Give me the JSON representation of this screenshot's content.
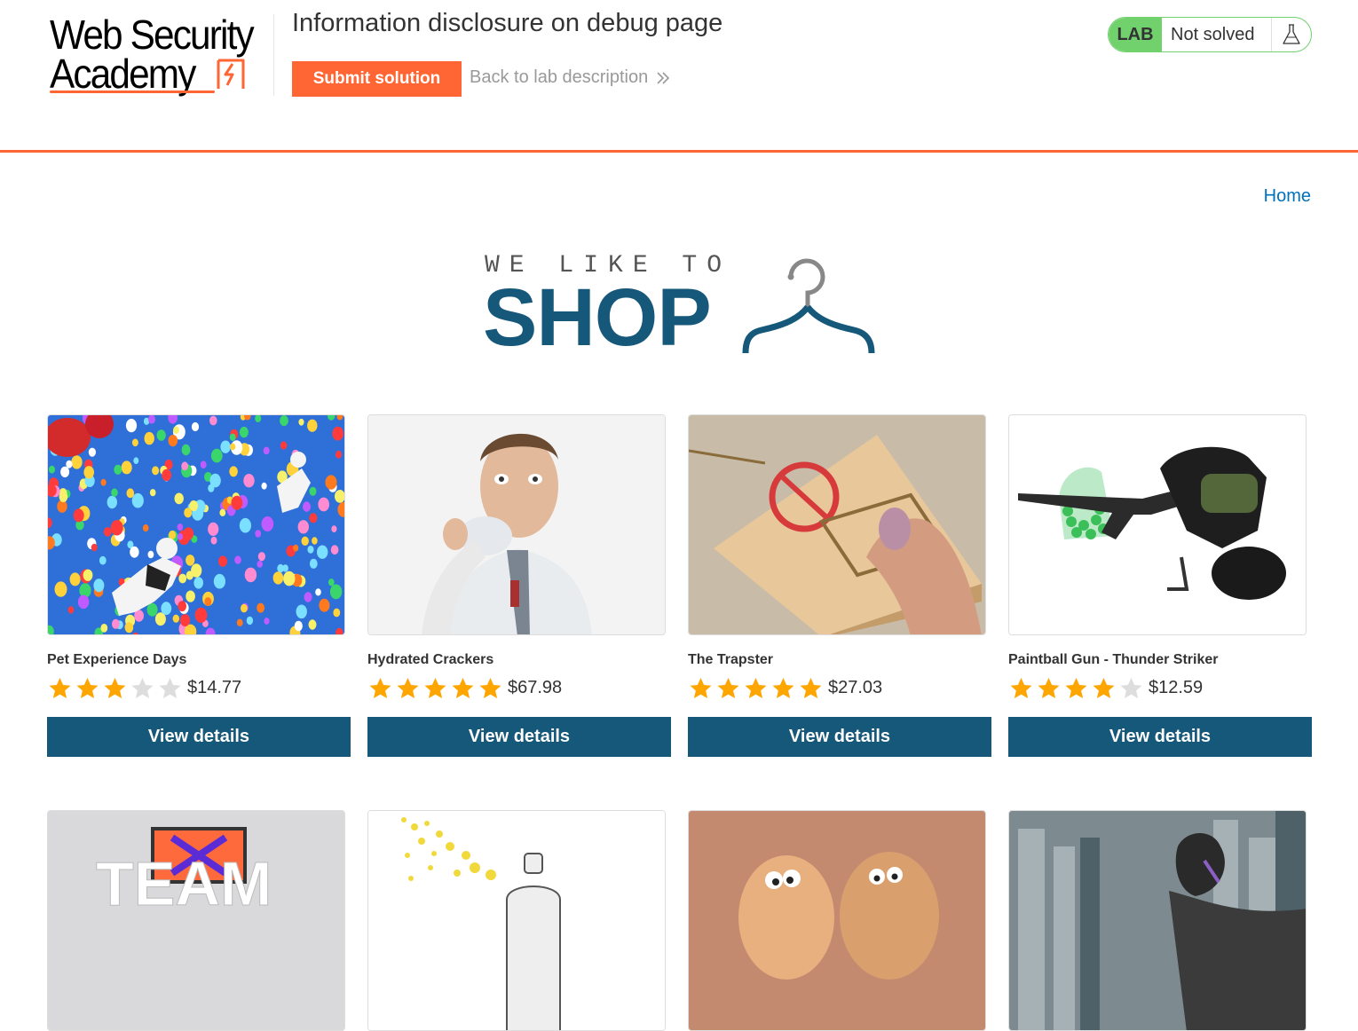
{
  "header": {
    "logo_line1": "Web Security",
    "logo_line2": "Academy",
    "lab_title": "Information disclosure on debug page",
    "submit_label": "Submit solution",
    "back_label": "Back to lab description",
    "lab_badge": "LAB",
    "lab_status": "Not solved"
  },
  "nav": {
    "home_label": "Home"
  },
  "banner": {
    "tagline": "WE LIKE TO",
    "word": "SHOP"
  },
  "colors": {
    "accent": "#ff6633",
    "primary": "#16587a",
    "link": "#0071bc",
    "lab_green": "#70d16d",
    "star": "#ffa500",
    "star_empty": "#dddddd"
  },
  "products": [
    {
      "name": "Pet Experience Days",
      "rating": 3,
      "price": "$14.77",
      "button": "View details"
    },
    {
      "name": "Hydrated Crackers",
      "rating": 5,
      "price": "$67.98",
      "button": "View details"
    },
    {
      "name": "The Trapster",
      "rating": 5,
      "price": "$27.03",
      "button": "View details"
    },
    {
      "name": "Paintball Gun - Thunder Striker",
      "rating": 4,
      "price": "$12.59",
      "button": "View details"
    },
    {
      "name": "",
      "rating": 0,
      "price": "",
      "button": ""
    },
    {
      "name": "",
      "rating": 0,
      "price": "",
      "button": ""
    },
    {
      "name": "",
      "rating": 0,
      "price": "",
      "button": ""
    },
    {
      "name": "",
      "rating": 0,
      "price": "",
      "button": ""
    }
  ]
}
